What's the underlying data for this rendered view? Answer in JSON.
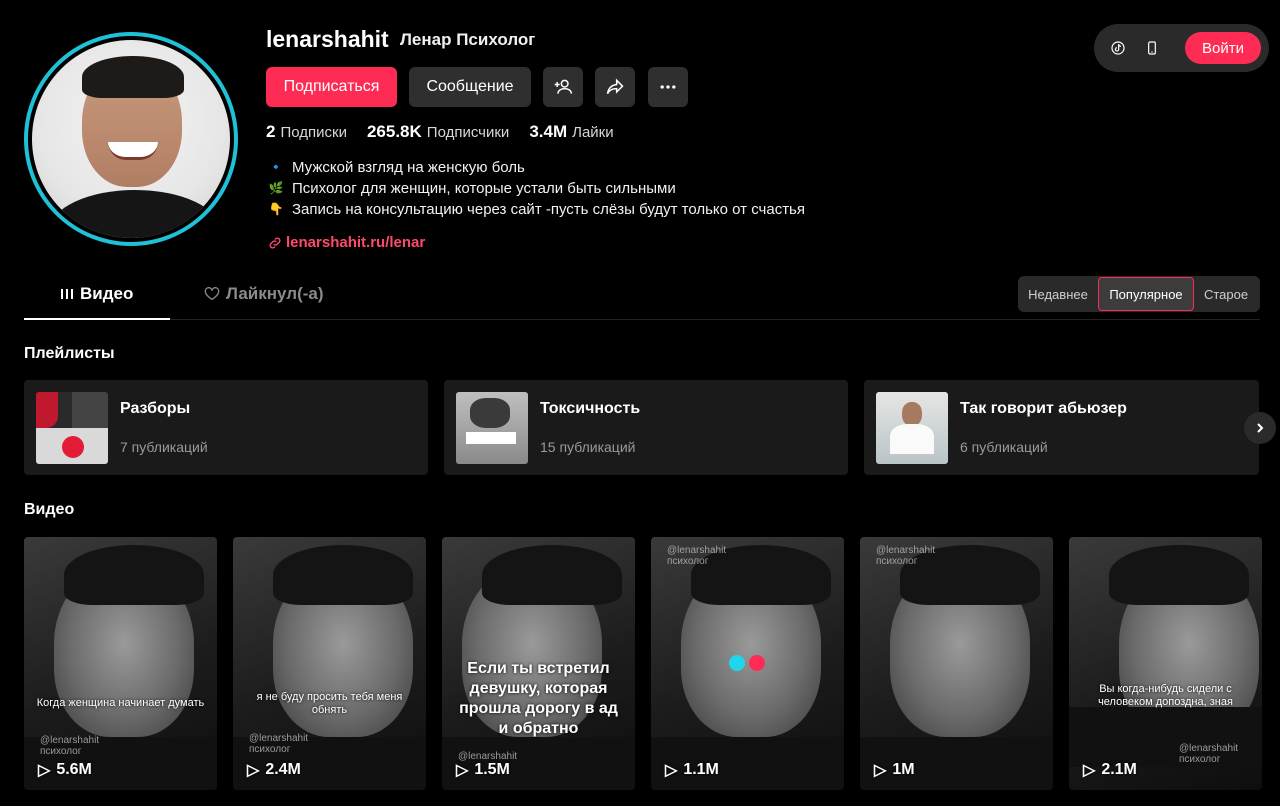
{
  "profile": {
    "username": "lenarshahit",
    "nickname": "Ленар Психолог",
    "follow_label": "Подписаться",
    "message_label": "Сообщение",
    "stats": {
      "following_count": "2",
      "following_label": "Подписки",
      "followers_count": "265.8K",
      "followers_label": "Подписчики",
      "likes_count": "3.4M",
      "likes_label": "Лайки"
    },
    "bio": [
      {
        "emoji": "🔹",
        "text": "Мужской взгляд на женскую боль"
      },
      {
        "emoji": "🌿",
        "text": "Психолог для женщин, которые устали быть сильными"
      },
      {
        "emoji": "👇",
        "text": "Запись на консультацию через сайт -пусть слёзы будут только от счастья"
      }
    ],
    "link": "lenarshahit.ru/lenar"
  },
  "topbar": {
    "login_label": "Войти",
    "icons": [
      "tiktok-icon",
      "mobile-icon"
    ]
  },
  "tabs": {
    "video_label": "Видео",
    "liked_label": "Лайкнул(-а)"
  },
  "sort": {
    "options": [
      "Недавнее",
      "Популярное",
      "Старое"
    ],
    "selected": "Популярное"
  },
  "playlists": {
    "title": "Плейлисты",
    "items": [
      {
        "title": "Разборы",
        "count": "7 публикаций"
      },
      {
        "title": "Токсичность",
        "count": "15 публикаций"
      },
      {
        "title": "Так говорит абьюзер",
        "count": "6 публикаций"
      }
    ]
  },
  "videos": {
    "title": "Видео",
    "items": [
      {
        "views": "5.6M",
        "caption": "Когда женщина начинает думать",
        "watermark": "@lenarshahit психолог"
      },
      {
        "views": "2.4M",
        "caption": "я не буду просить тебя меня обнять",
        "watermark": "@lenarshahit психолог"
      },
      {
        "views": "1.5M",
        "caption": "Если ты встретил девушку, которая прошла дорогу в ад и обратно",
        "watermark": "@lenarshahit"
      },
      {
        "views": "1.1M",
        "caption": "",
        "watermark": "@lenarshahit психолог"
      },
      {
        "views": "1M",
        "caption": "",
        "watermark": "@lenarshahit психолог"
      },
      {
        "views": "2.1M",
        "caption": "Вы когда-нибудь сидели с человеком допоздна, зная",
        "watermark": "@lenarshahit психолог"
      }
    ]
  },
  "colors": {
    "accent": "#fe2c55",
    "avatar_ring": "#20c0d6",
    "link": "#fe4a6a"
  }
}
